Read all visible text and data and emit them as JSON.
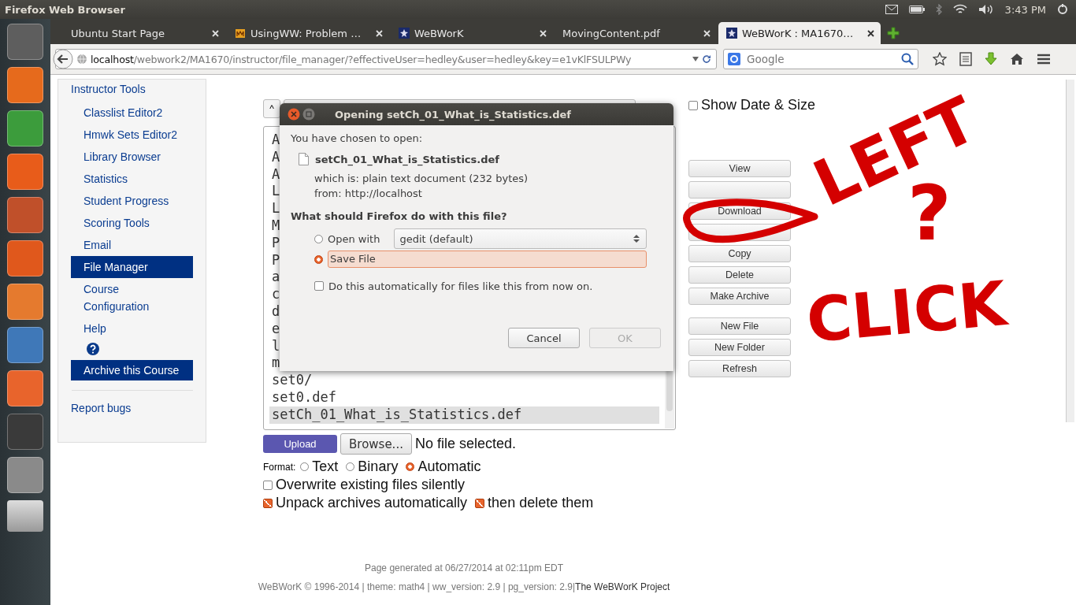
{
  "top_panel": {
    "app_title": "Firefox Web Browser",
    "clock": "3:43 PM"
  },
  "tabs": [
    {
      "title": "Ubuntu Start Page",
      "selected": false
    },
    {
      "title": "UsingWW: Problem …",
      "selected": false
    },
    {
      "title": "WeBWorK",
      "selected": false
    },
    {
      "title": "MovingContent.pdf",
      "selected": false
    },
    {
      "title": "WeBWorK : MA1670…",
      "selected": true
    }
  ],
  "address_bar": {
    "host": "localhost",
    "path": "/webwork2/MA1670/instructor/file_manager/?effectiveUser=hedley&user=hedley&key=e1vKlFSULPWy",
    "search_placeholder": "Google"
  },
  "sidebar": {
    "heading": "Instructor Tools",
    "items": [
      {
        "label": "Classlist Editor2",
        "selected": false
      },
      {
        "label": "Hmwk Sets Editor2",
        "selected": false
      },
      {
        "label": "Library Browser",
        "selected": false
      },
      {
        "label": "Statistics",
        "selected": false
      },
      {
        "label": "Student Progress",
        "selected": false
      },
      {
        "label": "Scoring Tools",
        "selected": false
      },
      {
        "label": "Email",
        "selected": false
      },
      {
        "label": "File Manager",
        "selected": true
      },
      {
        "label": "Course Configuration",
        "selected": false
      },
      {
        "label": "Help",
        "selected": false
      }
    ],
    "archive_button": "Archive this Course",
    "report_link": "Report bugs"
  },
  "file_manager": {
    "up_button": "^",
    "show_date_size": {
      "label": "Show Date & Size",
      "checked": false
    },
    "files": [
      {
        "name": "A",
        "selected": false
      },
      {
        "name": "A",
        "selected": false
      },
      {
        "name": "A",
        "selected": false
      },
      {
        "name": "L",
        "selected": false
      },
      {
        "name": "L",
        "selected": false
      },
      {
        "name": "M",
        "selected": false
      },
      {
        "name": "P",
        "selected": false
      },
      {
        "name": "P",
        "selected": false
      },
      {
        "name": "a",
        "selected": false
      },
      {
        "name": "c",
        "selected": false
      },
      {
        "name": "d",
        "selected": false
      },
      {
        "name": "e",
        "selected": false
      },
      {
        "name": "l",
        "selected": false
      },
      {
        "name": "m",
        "selected": false
      },
      {
        "name": "set0/",
        "selected": false
      },
      {
        "name": "set0.def",
        "selected": false
      },
      {
        "name": "setCh_01_What_is_Statistics.def",
        "selected": true
      }
    ],
    "actions": [
      {
        "kind": "button",
        "label": "View"
      },
      {
        "kind": "covered"
      },
      {
        "kind": "button",
        "label": "Download"
      },
      {
        "kind": "covered"
      },
      {
        "kind": "button",
        "label": "Copy"
      },
      {
        "kind": "button",
        "label": "Delete"
      },
      {
        "kind": "button",
        "label": "Make Archive"
      }
    ],
    "create_actions": [
      {
        "label": "New File"
      },
      {
        "label": "New Folder"
      },
      {
        "label": "Refresh"
      }
    ],
    "upload": {
      "button": "Upload",
      "browse": "Browse...",
      "status": "No file selected."
    },
    "format": {
      "label": "Format:",
      "options": [
        {
          "label": "Text",
          "selected": false
        },
        {
          "label": "Binary",
          "selected": false
        },
        {
          "label": "Automatic",
          "selected": true
        }
      ]
    },
    "overwrite": {
      "label": "Overwrite existing files silently",
      "checked": false
    },
    "unpack": {
      "label": "Unpack archives automatically",
      "checked": true
    },
    "delete_after": {
      "label": "then delete them",
      "checked": true
    }
  },
  "dialog": {
    "title": "Opening setCh_01_What_is_Statistics.def",
    "intro": "You have chosen to open:",
    "file_name": "setCh_01_What_is_Statistics.def",
    "which_is": "which is:  plain text document (232 bytes)",
    "from": "from:  http://localhost",
    "question": "What should Firefox do with this file?",
    "options": [
      {
        "kind": "open",
        "label": "Open with",
        "app": "gedit (default)",
        "selected": false
      },
      {
        "kind": "save",
        "label": "Save File",
        "selected": true
      }
    ],
    "remember": {
      "label": "Do this automatically for files like this from now on.",
      "checked": false
    },
    "buttons": [
      {
        "label": "Cancel",
        "disabled": false
      },
      {
        "label": "OK",
        "disabled": true
      }
    ]
  },
  "footer": {
    "generated": "Page generated at 06/27/2014 at 02:11pm EDT",
    "credits": "WeBWorK © 1996-2014 | theme: math4 | ww_version: 2.9 | pg_version: 2.9|",
    "project_link": "The WeBWorK Project"
  },
  "annotation": {
    "words": [
      "LEFT",
      "?",
      "CLICK"
    ]
  }
}
